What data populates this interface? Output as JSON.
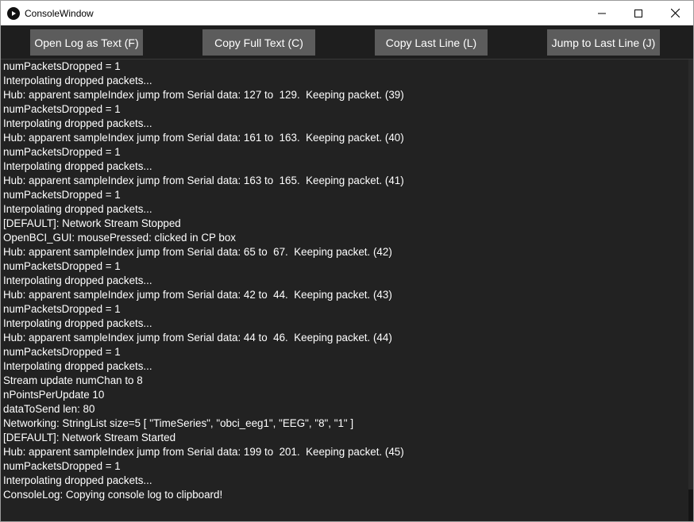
{
  "window": {
    "title": "ConsoleWindow",
    "icon": "play-circle-icon",
    "controls": [
      "minimize-icon",
      "maximize-icon",
      "close-icon"
    ]
  },
  "toolbar": {
    "open_log": "Open Log as Text (F)",
    "copy_full": "Copy Full Text (C)",
    "copy_last": "Copy Last Line (L)",
    "jump_last": "Jump to Last Line (J)"
  },
  "colors": {
    "background": "#222222",
    "toolbar_bg": "#1e1e1e",
    "button_bg": "#5c5c5c",
    "text": "#ffffff"
  },
  "log": [
    "numPacketsDropped = 1",
    "Interpolating dropped packets...",
    "Hub: apparent sampleIndex jump from Serial data: 127 to  129.  Keeping packet. (39)",
    "numPacketsDropped = 1",
    "Interpolating dropped packets...",
    "Hub: apparent sampleIndex jump from Serial data: 161 to  163.  Keeping packet. (40)",
    "numPacketsDropped = 1",
    "Interpolating dropped packets...",
    "Hub: apparent sampleIndex jump from Serial data: 163 to  165.  Keeping packet. (41)",
    "numPacketsDropped = 1",
    "Interpolating dropped packets...",
    "[DEFAULT]: Network Stream Stopped",
    "OpenBCI_GUI: mousePressed: clicked in CP box",
    "Hub: apparent sampleIndex jump from Serial data: 65 to  67.  Keeping packet. (42)",
    "numPacketsDropped = 1",
    "Interpolating dropped packets...",
    "Hub: apparent sampleIndex jump from Serial data: 42 to  44.  Keeping packet. (43)",
    "numPacketsDropped = 1",
    "Interpolating dropped packets...",
    "Hub: apparent sampleIndex jump from Serial data: 44 to  46.  Keeping packet. (44)",
    "numPacketsDropped = 1",
    "Interpolating dropped packets...",
    "Stream update numChan to 8",
    "nPointsPerUpdate 10",
    "dataToSend len: 80",
    "Networking: StringList size=5 [ \"TimeSeries\", \"obci_eeg1\", \"EEG\", \"8\", \"1\" ]",
    "[DEFAULT]: Network Stream Started",
    "Hub: apparent sampleIndex jump from Serial data: 199 to  201.  Keeping packet. (45)",
    "numPacketsDropped = 1",
    "Interpolating dropped packets...",
    "ConsoleLog: Copying console log to clipboard!"
  ]
}
